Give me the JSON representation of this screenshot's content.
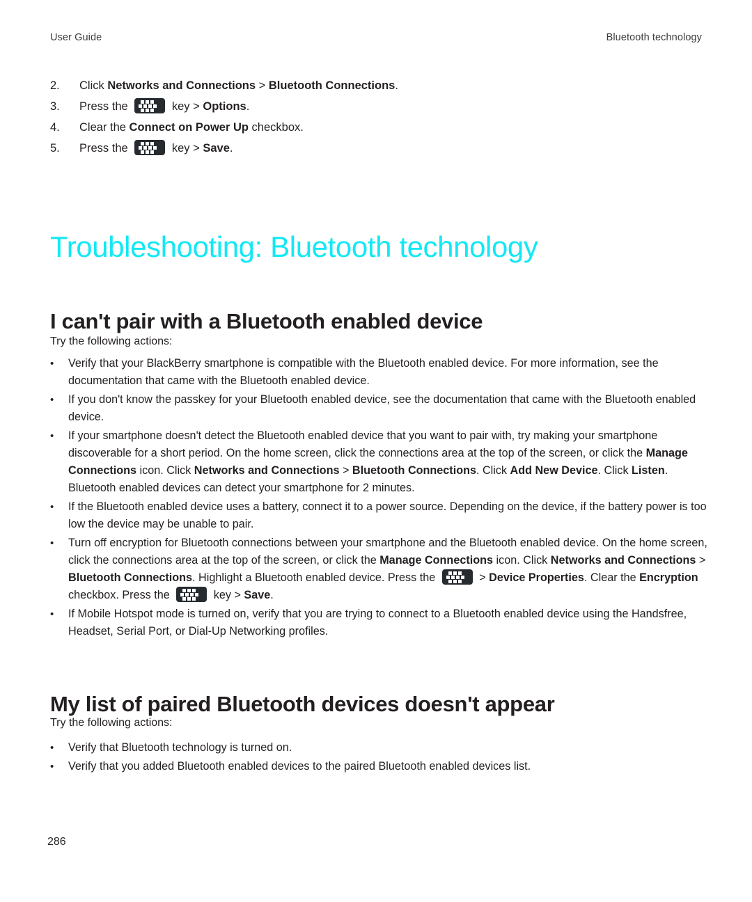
{
  "header": {
    "left": "User Guide",
    "right": "Bluetooth technology"
  },
  "colors": {
    "chapter_heading": "#12e8f5",
    "body_text": "#231f20",
    "key_icon_bg": "#262b30"
  },
  "steps": [
    {
      "number": "2.",
      "parts": [
        {
          "text": "Click ",
          "bold": false
        },
        {
          "text": "Networks and Connections",
          "bold": true
        },
        {
          "text": " > ",
          "bold": false
        },
        {
          "text": "Bluetooth Connections",
          "bold": true
        },
        {
          "text": ".",
          "bold": false
        }
      ]
    },
    {
      "number": "3.",
      "parts": [
        {
          "text": "Press the ",
          "bold": false
        },
        {
          "icon": "blackberry-menu-key"
        },
        {
          "text": " key > ",
          "bold": false
        },
        {
          "text": "Options",
          "bold": true
        },
        {
          "text": ".",
          "bold": false
        }
      ]
    },
    {
      "number": "4.",
      "parts": [
        {
          "text": "Clear the ",
          "bold": false
        },
        {
          "text": "Connect on Power Up",
          "bold": true
        },
        {
          "text": " checkbox.",
          "bold": false
        }
      ]
    },
    {
      "number": "5.",
      "parts": [
        {
          "text": "Press the ",
          "bold": false
        },
        {
          "icon": "blackberry-menu-key"
        },
        {
          "text": " key > ",
          "bold": false
        },
        {
          "text": "Save",
          "bold": true
        },
        {
          "text": ".",
          "bold": false
        }
      ]
    }
  ],
  "chapter_heading": "Troubleshooting: Bluetooth technology",
  "sections": [
    {
      "title": "I can't pair with a Bluetooth enabled device",
      "intro": "Try the following actions:",
      "bullets": [
        {
          "marker": "•",
          "parts": [
            {
              "text": "Verify that your BlackBerry smartphone is compatible with the Bluetooth enabled device. For more information, see the documentation that came with the Bluetooth enabled device.",
              "bold": false
            }
          ]
        },
        {
          "marker": "•",
          "parts": [
            {
              "text": "If you don't know the passkey for your Bluetooth enabled device, see the documentation that came with the Bluetooth enabled device.",
              "bold": false
            }
          ]
        },
        {
          "marker": "•",
          "parts": [
            {
              "text": "If your smartphone doesn't detect the Bluetooth enabled device that you want to pair with, try making your smartphone discoverable for a short period. On the home screen, click the connections area at the top of the screen, or click the ",
              "bold": false
            },
            {
              "text": "Manage Connections",
              "bold": true
            },
            {
              "text": " icon. Click ",
              "bold": false
            },
            {
              "text": "Networks and Connections",
              "bold": true
            },
            {
              "text": " > ",
              "bold": false
            },
            {
              "text": "Bluetooth Connections",
              "bold": true
            },
            {
              "text": ". Click ",
              "bold": false
            },
            {
              "text": "Add New Device",
              "bold": true
            },
            {
              "text": ". Click ",
              "bold": false
            },
            {
              "text": "Listen",
              "bold": true
            },
            {
              "text": ". Bluetooth enabled devices can detect your smartphone for 2 minutes.",
              "bold": false
            }
          ]
        },
        {
          "marker": "•",
          "parts": [
            {
              "text": "If the Bluetooth enabled device uses a battery, connect it to a power source. Depending on the device, if the battery power is too low the device may be unable to pair.",
              "bold": false
            }
          ]
        },
        {
          "marker": "•",
          "parts": [
            {
              "text": "Turn off encryption for Bluetooth connections between your smartphone and the Bluetooth enabled device. On the home screen, click the connections area at the top of the screen, or click the ",
              "bold": false
            },
            {
              "text": "Manage Connections",
              "bold": true
            },
            {
              "text": " icon. Click ",
              "bold": false
            },
            {
              "text": "Networks and Connections",
              "bold": true
            },
            {
              "text": " > ",
              "bold": false
            },
            {
              "text": "Bluetooth Connections",
              "bold": true
            },
            {
              "text": ". Highlight a Bluetooth enabled device. Press the ",
              "bold": false
            },
            {
              "icon": "blackberry-menu-key"
            },
            {
              "text": " > ",
              "bold": false
            },
            {
              "text": "Device Properties",
              "bold": true
            },
            {
              "text": ". Clear the ",
              "bold": false
            },
            {
              "text": "Encryption",
              "bold": true
            },
            {
              "text": " checkbox. Press the ",
              "bold": false
            },
            {
              "icon": "blackberry-menu-key"
            },
            {
              "text": " key > ",
              "bold": false
            },
            {
              "text": "Save",
              "bold": true
            },
            {
              "text": ".",
              "bold": false
            }
          ]
        },
        {
          "marker": "•",
          "parts": [
            {
              "text": "If Mobile Hotspot mode is turned on, verify that you are trying to connect to a Bluetooth enabled device using the Handsfree, Headset, Serial Port, or Dial-Up Networking profiles.",
              "bold": false
            }
          ]
        }
      ]
    },
    {
      "title": "My list of paired Bluetooth devices doesn't appear",
      "intro": "Try the following actions:",
      "bullets": [
        {
          "marker": "•",
          "parts": [
            {
              "text": "Verify that Bluetooth technology is turned on.",
              "bold": false
            }
          ]
        },
        {
          "marker": "•",
          "parts": [
            {
              "text": "Verify that you added Bluetooth enabled devices to the paired Bluetooth enabled devices list.",
              "bold": false
            }
          ]
        }
      ]
    }
  ],
  "footer": {
    "page_number": "286"
  }
}
